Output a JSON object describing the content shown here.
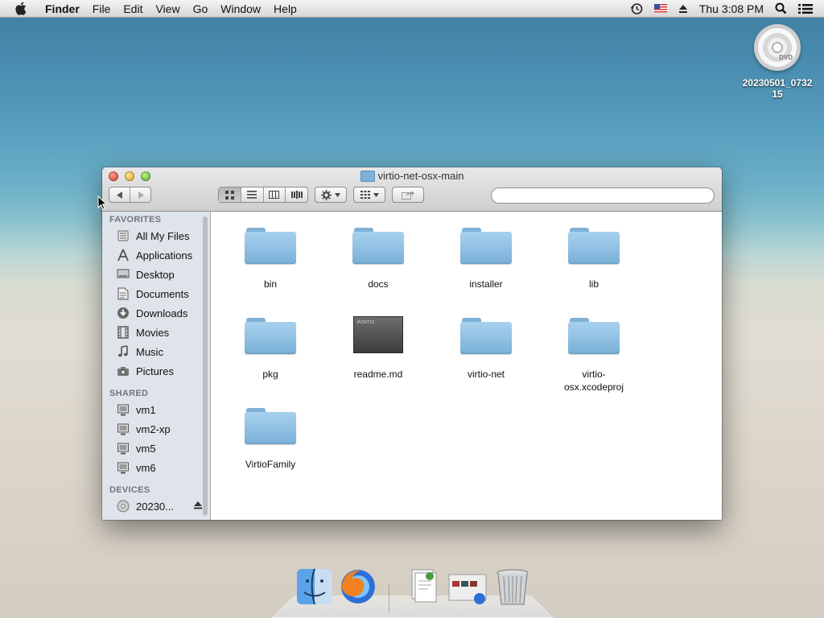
{
  "menubar": {
    "app_name": "Finder",
    "items": [
      "File",
      "Edit",
      "View",
      "Go",
      "Window",
      "Help"
    ],
    "clock": "Thu 3:08 PM",
    "status_icons": [
      "time-machine-icon",
      "us-flag-icon",
      "eject-icon",
      "spotlight-icon",
      "notification-list-icon"
    ]
  },
  "desktop": {
    "dvd_label": "20230501_073215"
  },
  "window": {
    "title": "virtio-net-osx-main",
    "search": {
      "value": "",
      "placeholder": ""
    },
    "view_modes": [
      "icon-view",
      "list-view",
      "column-view",
      "cover-flow-view"
    ],
    "active_view": "icon-view"
  },
  "sidebar": {
    "favorites_header": "FAVORITES",
    "favorites": [
      {
        "label": "All My Files",
        "icon": "all-files-icon"
      },
      {
        "label": "Applications",
        "icon": "applications-icon"
      },
      {
        "label": "Desktop",
        "icon": "desktop-icon"
      },
      {
        "label": "Documents",
        "icon": "documents-icon"
      },
      {
        "label": "Downloads",
        "icon": "downloads-icon"
      },
      {
        "label": "Movies",
        "icon": "movies-icon"
      },
      {
        "label": "Music",
        "icon": "music-icon"
      },
      {
        "label": "Pictures",
        "icon": "pictures-icon"
      }
    ],
    "shared_header": "SHARED",
    "shared": [
      {
        "label": "vm1"
      },
      {
        "label": "vm2-xp"
      },
      {
        "label": "vm5"
      },
      {
        "label": "vm6"
      }
    ],
    "devices_header": "DEVICES",
    "devices": [
      {
        "label": "20230..."
      }
    ]
  },
  "files": [
    {
      "name": "bin",
      "kind": "folder"
    },
    {
      "name": "docs",
      "kind": "folder"
    },
    {
      "name": "installer",
      "kind": "folder"
    },
    {
      "name": "lib",
      "kind": "folder"
    },
    {
      "name": "pkg",
      "kind": "folder"
    },
    {
      "name": "readme.md",
      "kind": "document"
    },
    {
      "name": "virtio-net",
      "kind": "folder"
    },
    {
      "name": "virtio-osx.xcodeproj",
      "kind": "folder"
    },
    {
      "name": "VirtioFamily",
      "kind": "folder"
    }
  ],
  "dock": {
    "apps": [
      "finder-icon",
      "firefox-icon",
      "documents-stack-icon",
      "downloads-stack-icon",
      "trash-icon"
    ]
  }
}
